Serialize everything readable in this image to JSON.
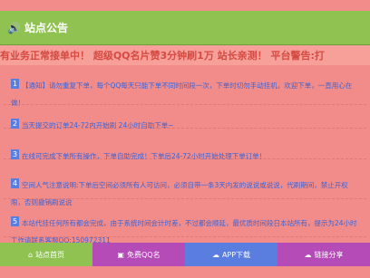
{
  "header": {
    "icon": "speaker-icon",
    "title": "站点公告"
  },
  "marquee": {
    "text": "有业务正常接单中！ 超级QQ名片赞3分钟刷1万 站长亲测！ 平台警告:打"
  },
  "notices": [
    {
      "number": "1",
      "text": "【通知】请勿重复下单，每个QQ每天只能下单不同时间段一次，下单时切勿手动挂机，欢迎下单，一直用心在做！"
    },
    {
      "number": "2",
      "text": "当天提交的订单24-72内开始刷 24小时自助下单~"
    },
    {
      "number": "3",
      "text": "在线可完成下单所有操作，下单自助完成！下单后24-72小时开始处理下单订单！"
    },
    {
      "number": "4",
      "text": "空间人气注意说明:下单后空间必须所有人可访问，必须自带一条3天内发的说说或说说，代刷期间，禁止开权限，否则撤销刷说说"
    },
    {
      "number": "5",
      "text": "本站代挂任何所有都会完成，由于系统时间会计时差，不过都会顺延，最优质时间段日本站所有，提示为24小时工作请联系客服QQ:150972311"
    }
  ],
  "bottom_tabs": [
    {
      "icon": "home-icon",
      "label": "站点首页"
    },
    {
      "icon": "gift-icon",
      "label": "免费QQ名"
    },
    {
      "icon": "cloud-icon",
      "label": "APP下载"
    },
    {
      "icon": "cloud-icon",
      "label": "链接分享"
    }
  ]
}
